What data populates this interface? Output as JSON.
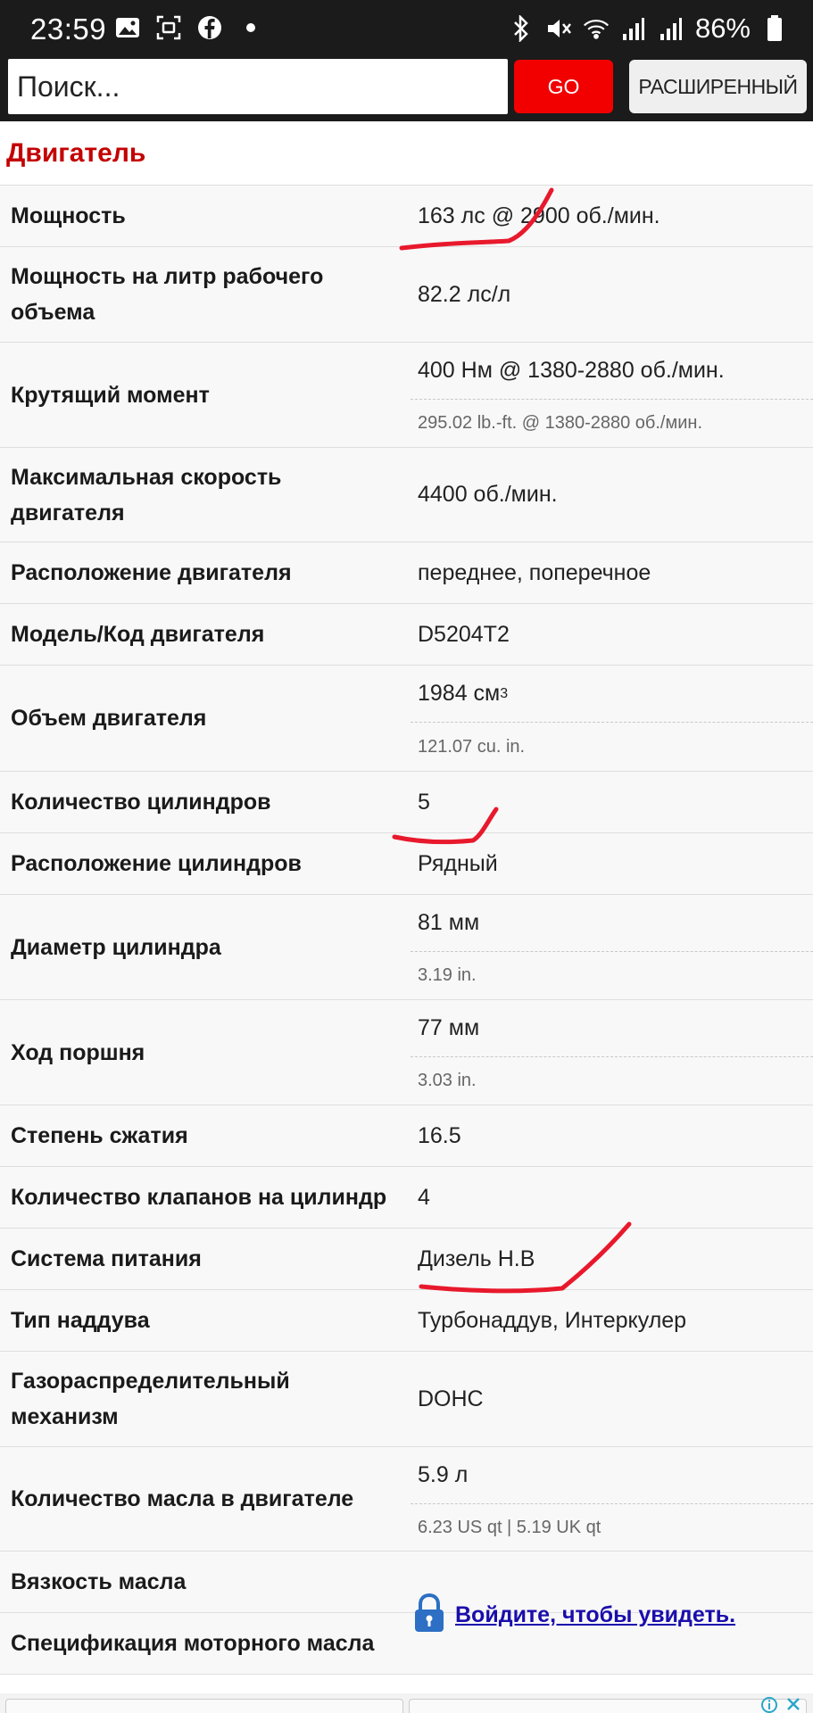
{
  "status_bar": {
    "time": "23:59",
    "battery": "86%",
    "left_icons": [
      "gallery-icon",
      "screenshot-icon",
      "facebook-icon",
      "dot-icon"
    ],
    "right_icons": [
      "bluetooth-icon",
      "mute-icon",
      "wifi-icon",
      "signal-icon",
      "signal-icon",
      "battery-icon"
    ]
  },
  "search": {
    "placeholder": "Поиск...",
    "go_label": "GO",
    "advanced_label": "РАСШИРЕННЫЙ"
  },
  "section": {
    "title": "Двигатель",
    "rows": [
      {
        "label": "Мощность",
        "value": "163 лс @ 2900 об./мин."
      },
      {
        "label": "Мощность на литр рабочего объема",
        "value": "82.2 лс/л"
      },
      {
        "label": "Крутящий момент",
        "value": "400 Нм @ 1380-2880 об./мин.",
        "sub": "295.02 lb.-ft. @ 1380-2880 об./мин."
      },
      {
        "label": "Максимальная скорость двигателя",
        "value": "4400 об./мин."
      },
      {
        "label": "Расположение двигателя",
        "value": "переднее, поперечное"
      },
      {
        "label": "Модель/Код двигателя",
        "value": "D5204T2"
      },
      {
        "label": "Объем двигателя",
        "value": "1984 см",
        "value_sup": "3",
        "sub": "121.07 cu. in."
      },
      {
        "label": "Количество цилиндров",
        "value": "5"
      },
      {
        "label": "Расположение цилиндров",
        "value": "Рядный"
      },
      {
        "label": "Диаметр цилиндра",
        "value": "81 мм",
        "sub": "3.19 in."
      },
      {
        "label": "Ход поршня",
        "value": "77 мм",
        "sub": "3.03 in."
      },
      {
        "label": "Степень сжатия",
        "value": "16.5"
      },
      {
        "label": "Количество клапанов на цилиндр",
        "value": "4"
      },
      {
        "label": "Система питания",
        "value": "Дизель Н.В"
      },
      {
        "label": "Тип наддува",
        "value": "Турбонаддув, Интеркулер"
      },
      {
        "label": "Газораспределительный механизм",
        "value": "DOHC"
      },
      {
        "label": "Количество масла в двигателе",
        "value": "5.9 л",
        "sub": "6.23 US qt | 5.19 UK qt"
      },
      {
        "label": "Вязкость масла"
      },
      {
        "label": "Спецификация моторного масла"
      }
    ],
    "login_link": "Войдите, чтобы увидеть."
  },
  "colors": {
    "accent_red": "#f20000",
    "section_title": "#c40000",
    "link": "#1a0dab",
    "annotation_red": "#e8192c"
  }
}
